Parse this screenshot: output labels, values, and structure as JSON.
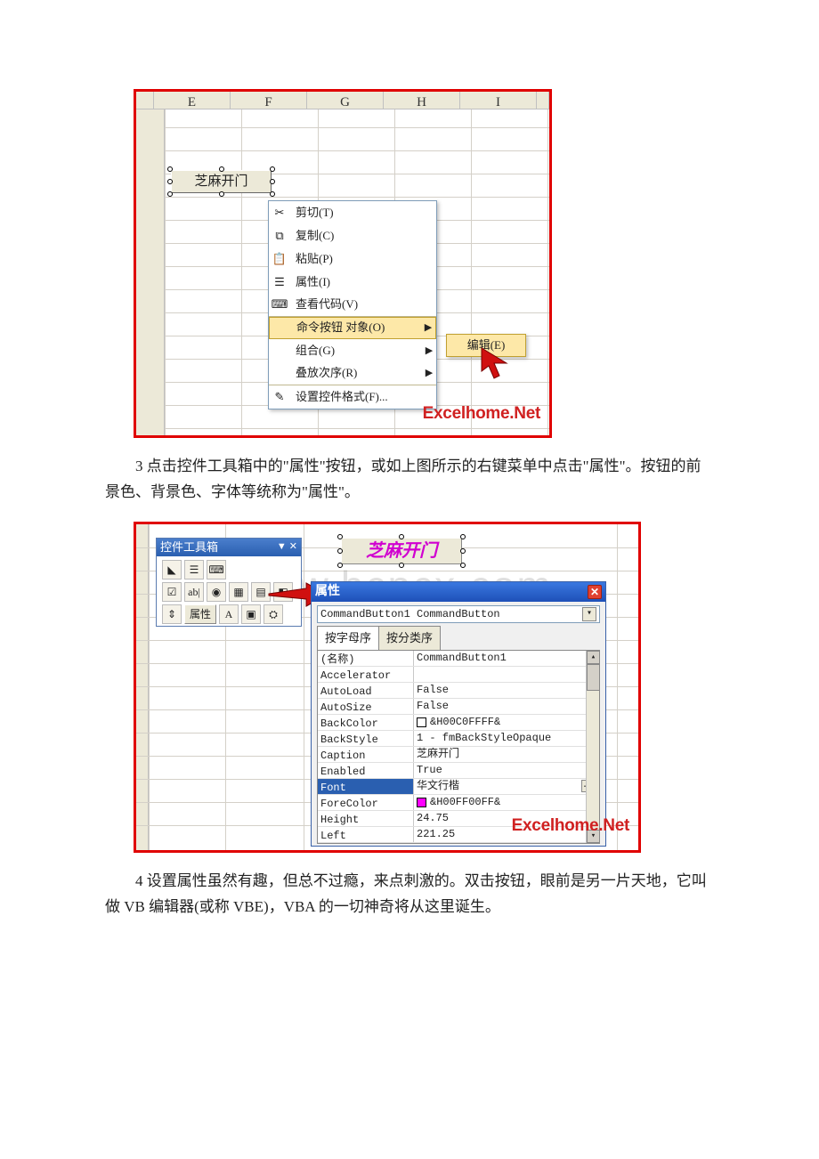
{
  "fig1": {
    "columns": [
      "E",
      "F",
      "G",
      "H",
      "I"
    ],
    "button_caption": "芝麻开门",
    "context_menu": [
      {
        "icon": "✂",
        "label": "剪切(T)"
      },
      {
        "icon": "⧉",
        "label": "复制(C)"
      },
      {
        "icon": "📋",
        "label": "粘贴(P)"
      },
      {
        "icon": "☰",
        "label": "属性(I)"
      },
      {
        "icon": "⌨",
        "label": "查看代码(V)"
      },
      {
        "icon": "",
        "label": "命令按钮 对象(O)",
        "submenu": true,
        "hl": true
      },
      {
        "icon": "",
        "label": "组合(G)",
        "submenu": true
      },
      {
        "icon": "",
        "label": "叠放次序(R)",
        "submenu": true
      },
      {
        "icon": "✎",
        "label": "设置控件格式(F)..."
      }
    ],
    "submenu_label": "编辑(E)",
    "watermark": "Excelhome.Net"
  },
  "para3": "3 点击控件工具箱中的\"属性\"按钮，或如上图所示的右键菜单中点击\"属性\"。按钮的前景色、背景色、字体等统称为\"属性\"。",
  "fig2": {
    "toolbox": {
      "title": "控件工具箱",
      "prop_button_label": "属性"
    },
    "button_caption": "芝麻开门",
    "ghost_watermark": "www.bcpcx.com",
    "properties_window": {
      "title": "属性",
      "combo_label": "CommandButton1 CommandButton",
      "tabs": [
        "按字母序",
        "按分类序"
      ],
      "rows": [
        {
          "k": "(名称)",
          "v": "CommandButton1"
        },
        {
          "k": "Accelerator",
          "v": ""
        },
        {
          "k": "AutoLoad",
          "v": "False"
        },
        {
          "k": "AutoSize",
          "v": "False"
        },
        {
          "k": "BackColor",
          "v": "&H00C0FFFF&",
          "swatch": "white"
        },
        {
          "k": "BackStyle",
          "v": "1 - fmBackStyleOpaque"
        },
        {
          "k": "Caption",
          "v": "芝麻开门"
        },
        {
          "k": "Enabled",
          "v": "True"
        },
        {
          "k": "Font",
          "v": "华文行楷",
          "sel": true,
          "ellipsis": true
        },
        {
          "k": "ForeColor",
          "v": "&H00FF00FF&",
          "swatch": "magenta"
        },
        {
          "k": "Height",
          "v": "24.75"
        },
        {
          "k": "Left",
          "v": "221.25"
        }
      ]
    },
    "watermark": "Excelhome.Net"
  },
  "para4": "4 设置属性虽然有趣，但总不过瘾，来点刺激的。双击按钮，眼前是另一片天地，它叫做 VB 编辑器(或称 VBE)，VBA 的一切神奇将从这里诞生。"
}
